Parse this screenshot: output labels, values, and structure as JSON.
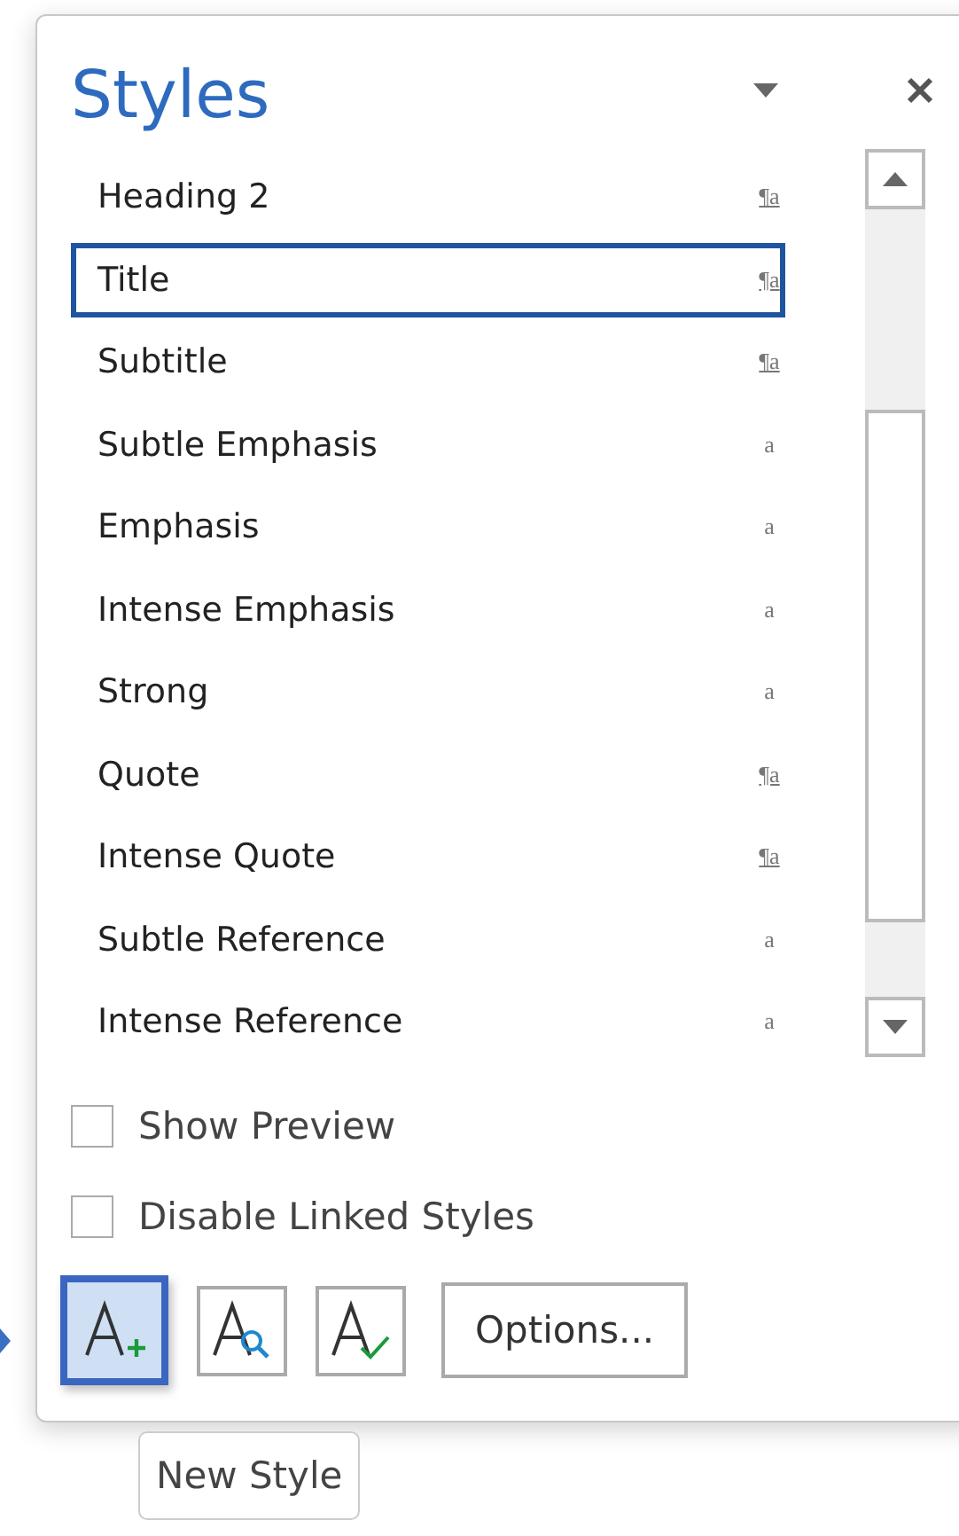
{
  "pane": {
    "title": "Styles"
  },
  "styles": [
    {
      "name": "Heading 2",
      "kind": "paragraph",
      "glyph": "¶a",
      "selected": false
    },
    {
      "name": "Title",
      "kind": "paragraph",
      "glyph": "¶a",
      "selected": true
    },
    {
      "name": "Subtitle",
      "kind": "paragraph",
      "glyph": "¶a",
      "selected": false
    },
    {
      "name": "Subtle Emphasis",
      "kind": "character",
      "glyph": "a",
      "selected": false
    },
    {
      "name": "Emphasis",
      "kind": "character",
      "glyph": "a",
      "selected": false
    },
    {
      "name": "Intense Emphasis",
      "kind": "character",
      "glyph": "a",
      "selected": false
    },
    {
      "name": "Strong",
      "kind": "character",
      "glyph": "a",
      "selected": false
    },
    {
      "name": "Quote",
      "kind": "paragraph",
      "glyph": "¶a",
      "selected": false
    },
    {
      "name": "Intense Quote",
      "kind": "paragraph",
      "glyph": "¶a",
      "selected": false
    },
    {
      "name": "Subtle Reference",
      "kind": "character",
      "glyph": "a",
      "selected": false
    },
    {
      "name": "Intense Reference",
      "kind": "character",
      "glyph": "a",
      "selected": false
    }
  ],
  "options": [
    {
      "label": "Show Preview",
      "checked": false
    },
    {
      "label": "Disable Linked Styles",
      "checked": false
    }
  ],
  "tools": [
    {
      "kind": "new",
      "selected": true
    },
    {
      "kind": "inspect",
      "selected": false
    },
    {
      "kind": "manage",
      "selected": false
    }
  ],
  "options_button": "Options...",
  "tooltip": "New Style"
}
